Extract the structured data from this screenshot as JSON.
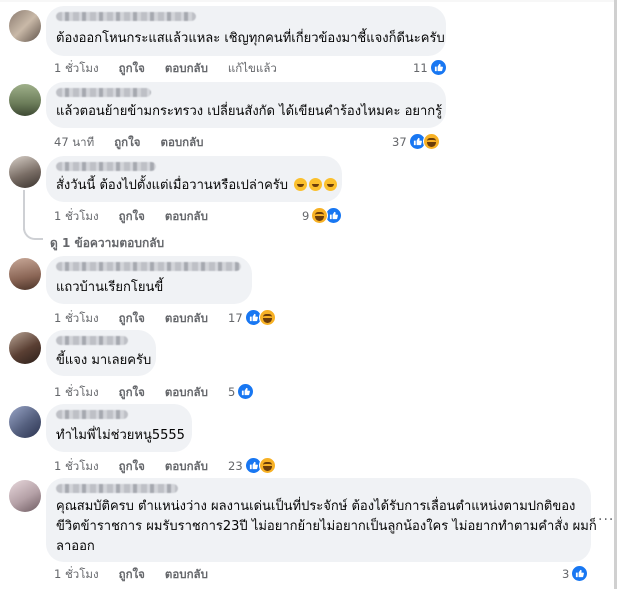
{
  "comments": [
    {
      "text": "ต้องออกโหนกระแสแล้วแหละ เชิญทุกคนที่เกี่ยวข้องมาชี้แจงก็ดีนะครับ",
      "time": "1 ชั่วโมง",
      "like": "ถูกใจ",
      "reply": "ตอบกลับ",
      "edited": "แก้ไขแล้ว",
      "reaction_count": "11"
    },
    {
      "text": "แล้วตอนย้ายข้ามกระทรวง เปลี่ยนสังกัด ได้เขียนคำร้องไหมคะ อยากรู้",
      "time": "47 นาที",
      "like": "ถูกใจ",
      "reply": "ตอบกลับ",
      "reaction_count": "37"
    },
    {
      "text": "สั่งวันนี้ ต้องไปตั้งแต่เมื่อวานหรือเปล่าครับ",
      "time": "1 ชั่วโมง",
      "like": "ถูกใจ",
      "reply": "ตอบกลับ",
      "reaction_count": "9"
    },
    {
      "text": "แถวบ้านเรียกโยนขี้",
      "time": "1 ชั่วโมง",
      "like": "ถูกใจ",
      "reply": "ตอบกลับ",
      "reaction_count": "17"
    },
    {
      "text": "ขี้แจง มาเลยครับ",
      "time": "1 ชั่วโมง",
      "like": "ถูกใจ",
      "reply": "ตอบกลับ",
      "reaction_count": "5"
    },
    {
      "text": "ทำไมพี่ไม่ช่วยหนู5555",
      "time": "1 ชั่วโมง",
      "like": "ถูกใจ",
      "reply": "ตอบกลับ",
      "reaction_count": "23"
    },
    {
      "text_lines": [
        "คุณสมบัติครบ ตำแหน่งว่าง ผลงานเด่นเป็นที่ประจักษ์ ต้องได้รับการเลื่อนตำแหน่งตามปกติของ",
        "ขีวิตข้าราชการ ผมรับราชการ23ปี ไม่อยากย้ายไม่อยากเป็นลูกน้องใคร ไม่อยากทำตามคำสั่ง ผมก็",
        "ลาออก"
      ],
      "time": "1 ชั่วโมง",
      "like": "ถูกใจ",
      "reply": "ตอบกลับ",
      "reaction_count": "3"
    }
  ],
  "view_replies": "ดู 1 ข้อความตอบกลับ",
  "more_options": "···",
  "colors": {
    "bubble": "#f0f2f5",
    "meta": "#65676b",
    "like_blue": "#1877f2",
    "haha_yellow": "#f7b125"
  },
  "icons": [
    "like-icon",
    "haha-icon",
    "more-options-icon"
  ]
}
